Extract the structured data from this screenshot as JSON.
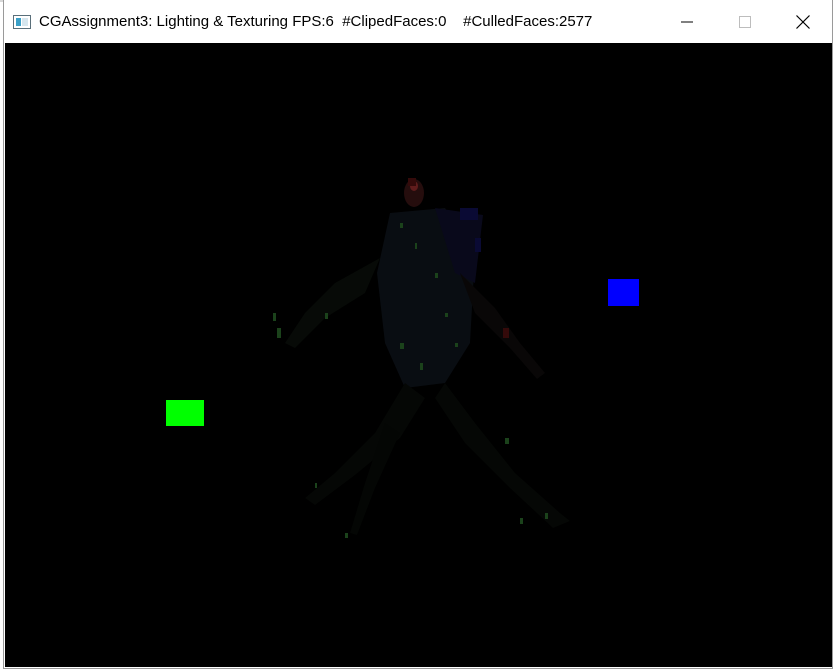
{
  "window": {
    "title": "CGAssignment3: Lighting & Texturing FPS:6  #ClipedFaces:0    #CulledFaces:2577",
    "icon": "app-window-icon",
    "controls": {
      "minimize": "minimize-icon",
      "maximize": "maximize-icon",
      "close": "close-icon"
    }
  },
  "scene": {
    "background": "#000000",
    "lights": [
      {
        "name": "green-light",
        "color": "#00ff00"
      },
      {
        "name": "blue-light",
        "color": "#0000ff"
      }
    ],
    "model": "dim-lit-3d-creature-model"
  }
}
